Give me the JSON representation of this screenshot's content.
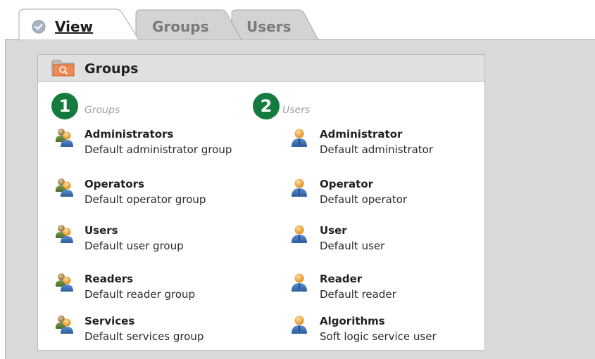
{
  "tabs": [
    {
      "label": "View",
      "active": true
    },
    {
      "label": "Groups",
      "active": false
    },
    {
      "label": "Users",
      "active": false
    }
  ],
  "panel": {
    "title": "Groups",
    "icon": "folder-search-icon"
  },
  "groups_column": {
    "badge": "1",
    "caption": "Groups",
    "items": [
      {
        "name": "Administrators",
        "description": "Default administrator group",
        "icon": "user-group-icon"
      },
      {
        "name": "Operators",
        "description": "Default operator group",
        "icon": "user-group-icon"
      },
      {
        "name": "Users",
        "description": "Default user group",
        "icon": "user-group-icon"
      },
      {
        "name": "Readers",
        "description": "Default reader group",
        "icon": "user-group-icon"
      },
      {
        "name": "Services",
        "description": "Default services group",
        "icon": "user-group-icon"
      }
    ]
  },
  "users_column": {
    "badge": "2",
    "caption": "Users",
    "items": [
      {
        "name": "Administrator",
        "description": "Default administrator",
        "icon": "user-icon"
      },
      {
        "name": "Operator",
        "description": "Default operator",
        "icon": "user-icon"
      },
      {
        "name": "User",
        "description": "Default user",
        "icon": "user-icon"
      },
      {
        "name": "Reader",
        "description": "Default reader",
        "icon": "user-icon"
      },
      {
        "name": "Algorithms",
        "description": "Soft logic service user",
        "icon": "user-icon"
      }
    ]
  },
  "colors": {
    "badge": "#157a3e",
    "frame": "#d9d9d9",
    "header": "#e0e0e0",
    "active_tab": "#ffffff",
    "inactive_tab": "#d3d3d3"
  }
}
